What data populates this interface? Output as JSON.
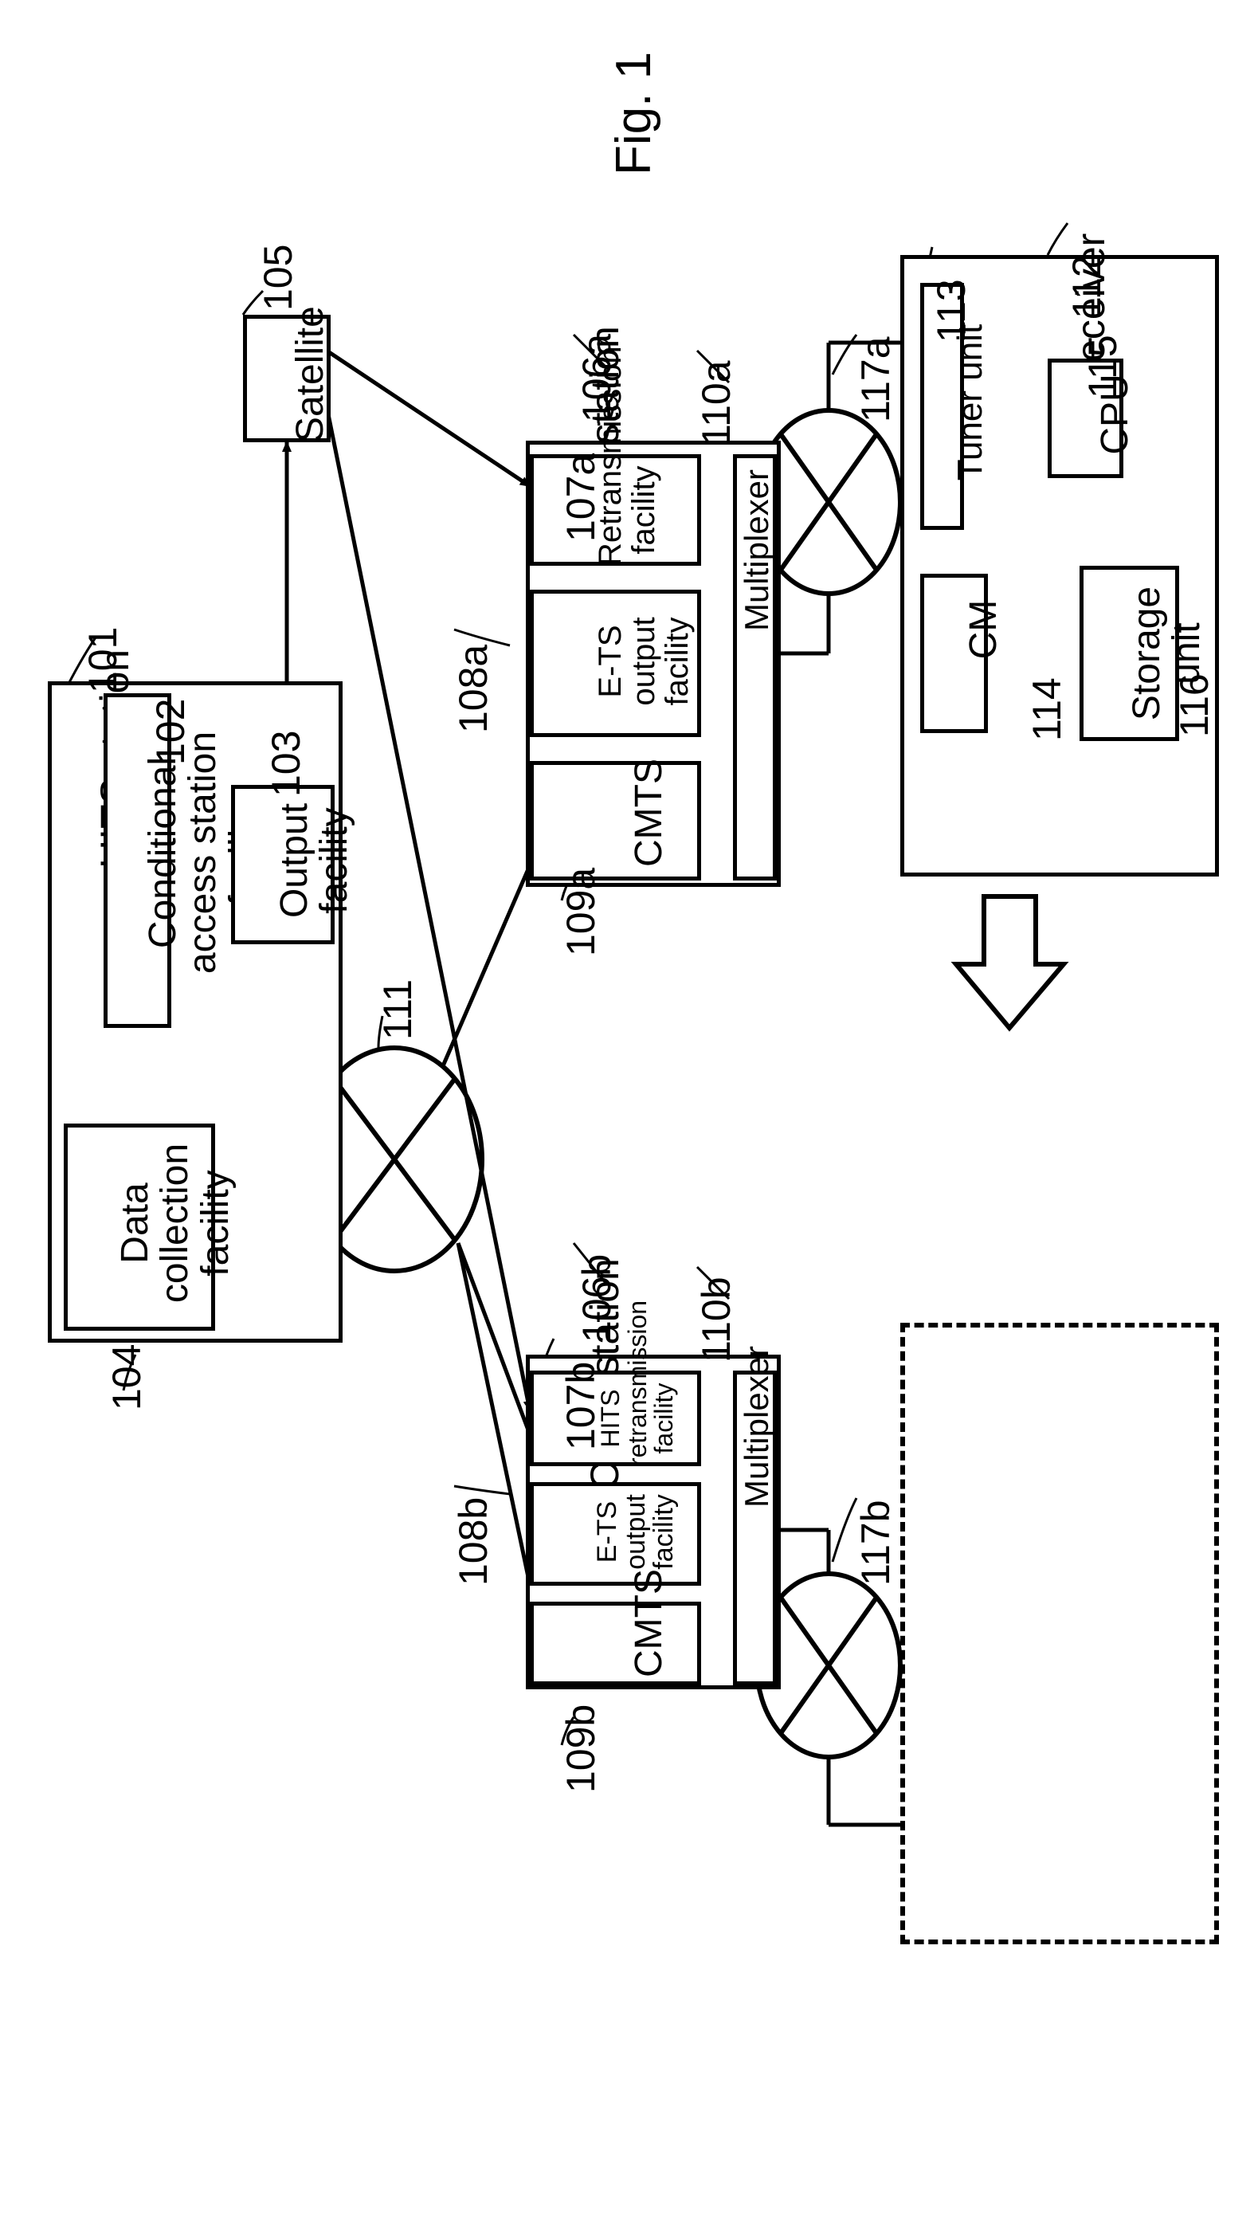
{
  "figure_title": "Fig. 1",
  "refnums": {
    "r101": "101",
    "r102": "102",
    "r103": "103",
    "r104": "104",
    "r105": "105",
    "r106a": "106a",
    "r106b": "106b",
    "r107a": "107a",
    "r107b": "107b",
    "r108a": "108a",
    "r108b": "108b",
    "r109a": "109a",
    "r109b": "109b",
    "r110a": "110a",
    "r110b": "110b",
    "r111": "111",
    "r112": "112",
    "r113": "113",
    "r114": "114",
    "r115": "115",
    "r116": "116",
    "r117a": "117a",
    "r117b": "117b"
  },
  "boxes": {
    "hits_station": "HITS station",
    "conditional_access": "Conditional\naccess\nstation\nfacility",
    "output_facility": "Output\nfacility",
    "data_collection": "Data collection\nfacility",
    "satellite": "Satellite",
    "catv_a": "CATV station",
    "retransmission_a": "Retransmission\nfacility",
    "ets_a": "E-TS output\nfacility",
    "cmts_a": "CMTS",
    "multiplexer_a": "Multiplexer",
    "catv_b": "CATV station",
    "hits_retransmission_b": "HITS\nretransmission\nfacility",
    "ets_b": "E-TS output\nfacility",
    "cmts_b": "CMTS",
    "multiplexer_b": "Multiplexer",
    "receiver": "Receiver",
    "tuner": "Tuner unit",
    "cm": "CM",
    "cpu": "CPU",
    "storage": "Storage\nunit"
  }
}
